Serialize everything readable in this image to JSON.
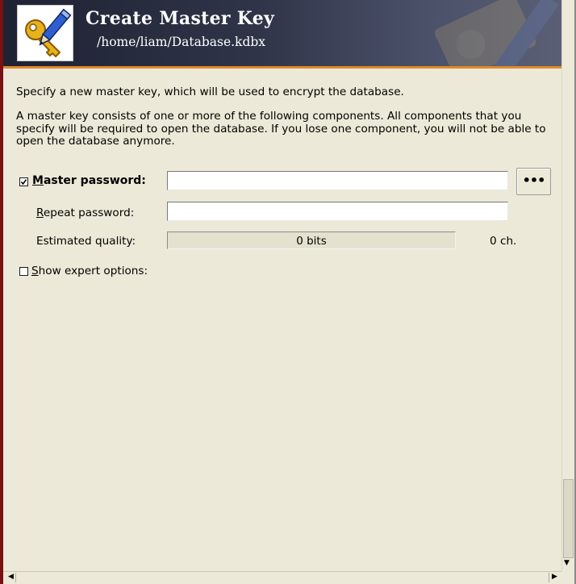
{
  "dialog": {
    "title": "Create Master Key",
    "subtitle": "/home/liam/Database.kdbx"
  },
  "intro": {
    "line1": "Specify a new master key, which will be used to encrypt the database.",
    "line2": "A master key consists of one or more of the following components. All components that you specify will be required to open the database. If you lose one component, you will not be able to open the database anymore."
  },
  "master_password": {
    "checked": true,
    "label_mnemonic": "M",
    "label_rest": "aster password:",
    "value": "",
    "show_button_label": "•••"
  },
  "repeat_password": {
    "label_mnemonic": "R",
    "label_rest": "epeat password:",
    "value": ""
  },
  "quality": {
    "label": "Estimated quality:",
    "bar_text": "0 bits",
    "fill_fraction": 0,
    "char_count": "0 ch."
  },
  "expert_options": {
    "checked": false,
    "label_mnemonic": "S",
    "label_rest": "how expert options:"
  },
  "colors": {
    "banner_accent": "#e08a2a",
    "quality_fill": "#3c7be0",
    "window_background": "#ece9d8"
  }
}
